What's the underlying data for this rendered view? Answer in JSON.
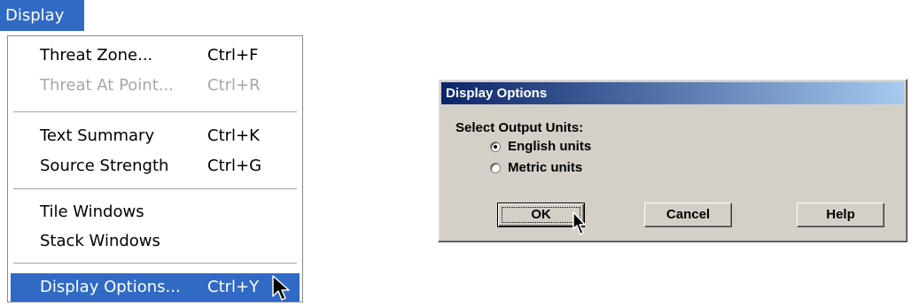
{
  "menu": {
    "title": "Display",
    "items": [
      {
        "label": "Threat Zone...",
        "shortcut": "Ctrl+F"
      },
      {
        "label": "Threat At Point...",
        "shortcut": "Ctrl+R"
      },
      {
        "label": "Text Summary",
        "shortcut": "Ctrl+K"
      },
      {
        "label": "Source Strength",
        "shortcut": "Ctrl+G"
      },
      {
        "label": "Tile Windows",
        "shortcut": ""
      },
      {
        "label": "Stack Windows",
        "shortcut": ""
      },
      {
        "label": "Display Options...",
        "shortcut": "Ctrl+Y"
      }
    ]
  },
  "dialog": {
    "title": "Display Options",
    "prompt": "Select Output Units:",
    "options": [
      {
        "label": "English units",
        "selected": true
      },
      {
        "label": "Metric units",
        "selected": false
      }
    ],
    "buttons": {
      "ok": "OK",
      "cancel": "Cancel",
      "help": "Help"
    }
  },
  "colors": {
    "highlight": "#316ac5",
    "dialog_face": "#d4d0c8",
    "titlebar_start": "#0a246a",
    "titlebar_end": "#a6caf0",
    "disabled_text": "#a7a7a7"
  }
}
